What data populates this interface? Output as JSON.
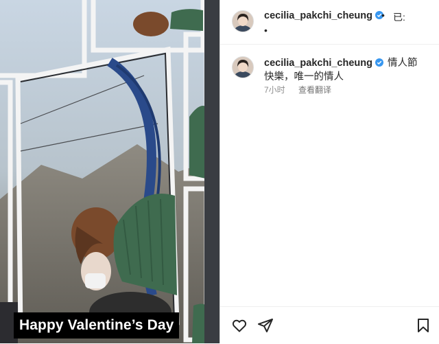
{
  "post": {
    "media": {
      "caption_text": "Happy Valentine’s Day"
    },
    "header": {
      "username": "cecilia_pakchi_cheung",
      "separator": "•",
      "follow_status": "已:",
      "second_dot": "•"
    },
    "comment": {
      "username": "cecilia_pakchi_cheung",
      "caption_line1": "情人節",
      "caption_line2": "快樂，唯一的情人",
      "time": "7小时",
      "translate_label": "查看翻译"
    },
    "icons": {
      "like": "heart-icon",
      "share": "paper-plane-icon",
      "save": "bookmark-icon",
      "verified": "verified-badge-icon"
    },
    "colors": {
      "verified": "#3897f0",
      "text": "#262626",
      "muted": "#8e8e8e"
    }
  }
}
